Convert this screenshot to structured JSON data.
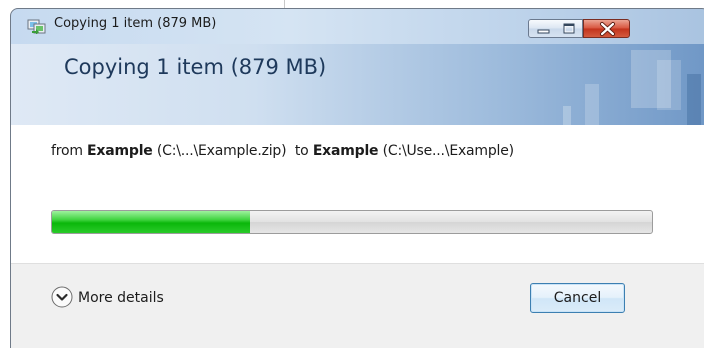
{
  "window": {
    "title": "Copying 1 item (879 MB)",
    "controls": {
      "minimize_icon": "minimize-icon",
      "maximize_icon": "maximize-icon",
      "close_icon": "close-icon"
    }
  },
  "header": {
    "title": "Copying 1 item (879 MB)"
  },
  "transfer": {
    "from_word": "from",
    "source_name": "Example",
    "source_path": "(C:\\...\\Example.zip)",
    "to_word": "to",
    "dest_name": "Example",
    "dest_path": "(C:\\Use...\\Example)"
  },
  "progress": {
    "fraction": 0.33
  },
  "footer": {
    "details_label": "More details",
    "details_icon": "chevron-down-circle-icon",
    "cancel_label": "Cancel"
  },
  "colors": {
    "accent": "#1e395b",
    "progress_green": "#0bb70b",
    "close_red": "#c2331c"
  }
}
